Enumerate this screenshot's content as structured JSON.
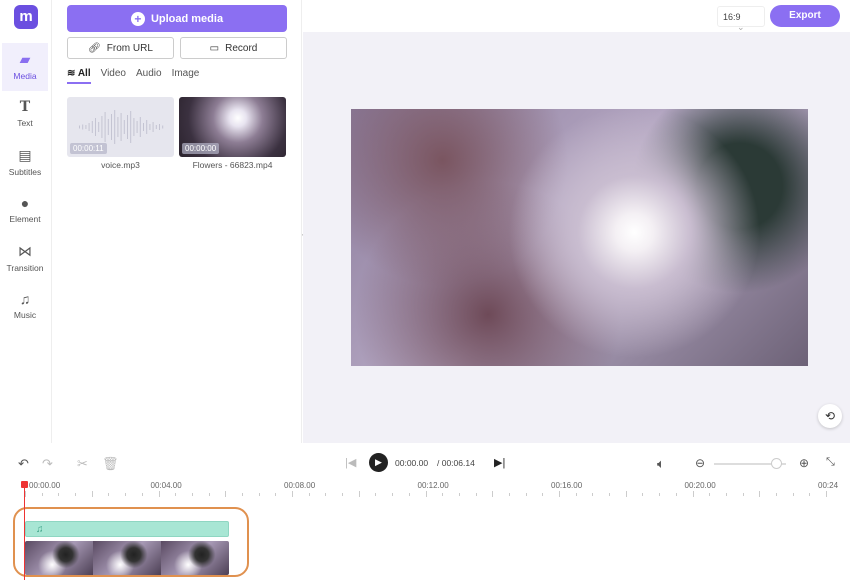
{
  "app": {
    "logo": "m"
  },
  "sidebar": {
    "items": [
      {
        "label": "Media",
        "icon": "folder-plus-icon",
        "active": true
      },
      {
        "label": "Text",
        "icon": "text-icon"
      },
      {
        "label": "Subtitles",
        "icon": "subtitles-icon"
      },
      {
        "label": "Element",
        "icon": "element-icon"
      },
      {
        "label": "Transition",
        "icon": "transition-icon"
      },
      {
        "label": "Music",
        "icon": "music-icon"
      }
    ]
  },
  "panel": {
    "upload": "Upload media",
    "from_url": "From URL",
    "record": "Record",
    "tabs": [
      "All",
      "Video",
      "Audio",
      "Image"
    ],
    "media": [
      {
        "name": "voice.mp3",
        "duration": "00:00:11"
      },
      {
        "name": "Flowers - 66823.mp4",
        "duration": "00:00:00"
      }
    ]
  },
  "header": {
    "ratio": "16:9",
    "export": "Export"
  },
  "timeline": {
    "current": "00:00.00",
    "total": "/ 00:06.14",
    "zoom_level": 0.86,
    "ruler": [
      "00:00.00",
      "00:04.00",
      "00:08.00",
      "00:12.00",
      "00:16.00",
      "00:20.00",
      "00:24"
    ]
  },
  "colors": {
    "accent": "#8b6ff2",
    "audio_track": "#a8e6d4",
    "highlight": "#e0914f",
    "playhead": "#e33333"
  }
}
